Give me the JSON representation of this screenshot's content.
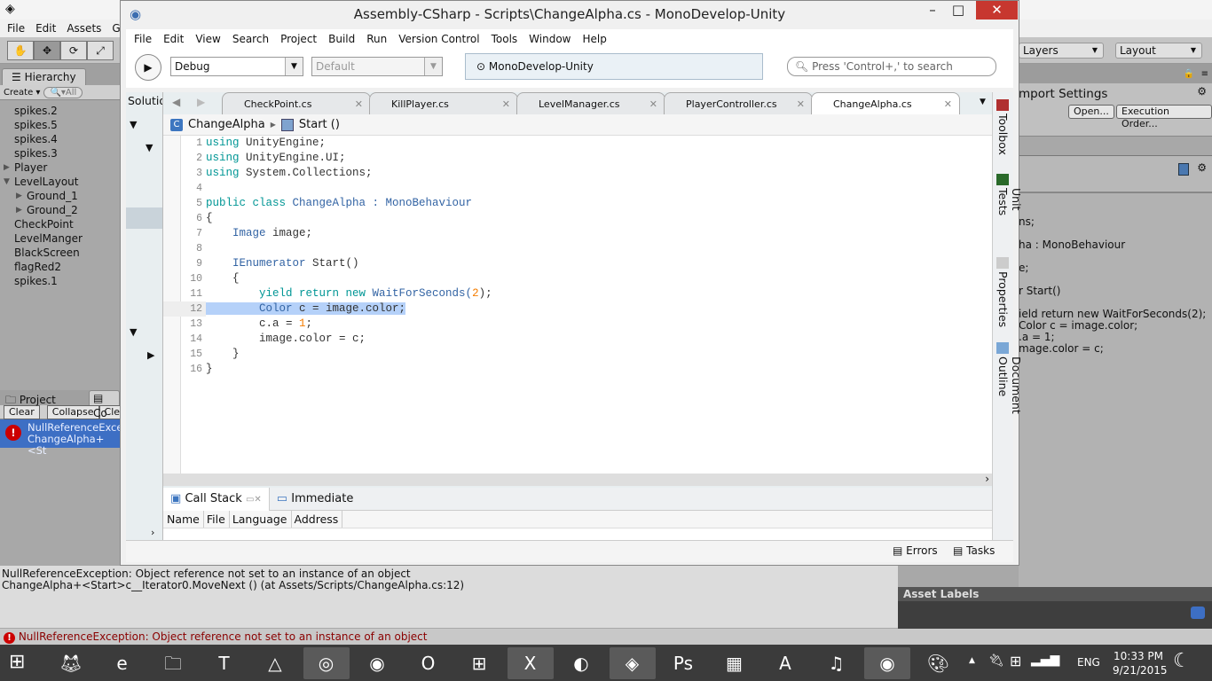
{
  "unity": {
    "menu": [
      "File",
      "Edit",
      "Assets",
      "Ga"
    ],
    "tools": [
      "hand-icon",
      "move-icon",
      "rotate-icon",
      "scale-icon"
    ],
    "hierarchy": {
      "tab": "Hierarchy",
      "create": "Create",
      "search": "All",
      "items": [
        {
          "label": "spikes.2",
          "indent": 0,
          "arrow": ""
        },
        {
          "label": "spikes.5",
          "indent": 0,
          "arrow": ""
        },
        {
          "label": "spikes.4",
          "indent": 0,
          "arrow": ""
        },
        {
          "label": "spikes.3",
          "indent": 0,
          "arrow": ""
        },
        {
          "label": "Player",
          "indent": 0,
          "arrow": "▶"
        },
        {
          "label": "LevelLayout",
          "indent": 0,
          "arrow": "▼"
        },
        {
          "label": "Ground_1",
          "indent": 1,
          "arrow": "▶"
        },
        {
          "label": "Ground_2",
          "indent": 1,
          "arrow": "▶"
        },
        {
          "label": "CheckPoint",
          "indent": 0,
          "arrow": ""
        },
        {
          "label": "LevelManger",
          "indent": 0,
          "arrow": ""
        },
        {
          "label": "BlackScreen",
          "indent": 0,
          "arrow": ""
        },
        {
          "label": "flagRed2",
          "indent": 0,
          "arrow": ""
        },
        {
          "label": "spikes.1",
          "indent": 0,
          "arrow": ""
        }
      ]
    },
    "project_tab": "Project",
    "console_tab": "Co",
    "console_buttons": [
      "Clear",
      "Collapse",
      "Clear"
    ],
    "console_entry": {
      "line1": "NullReferenceExce",
      "line2": "ChangeAlpha+<St"
    },
    "console_detail": [
      "NullReferenceException: Object reference not set to an instance of an object",
      "ChangeAlpha+<Start>c__Iterator0.MoveNext () (at Assets/Scripts/ChangeAlpha.cs:12)"
    ],
    "status": "NullReferenceException: Object reference not set to an instance of an object",
    "layers": "Layers",
    "layout": "Layout",
    "inspector": {
      "title": "Import Settings",
      "open": "Open...",
      "execution_order": "Execution Order...",
      "preview": [
        "ns;",
        "",
        "ha : MonoBehaviour",
        "",
        "e;",
        "",
        "r Start()",
        "",
        "ield return new WaitForSeconds(2);",
        "Color c = image.color;",
        ".a = 1;",
        "mage.color = c;"
      ]
    },
    "asset_labels": "Asset Labels"
  },
  "md": {
    "title": "Assembly-CSharp - Scripts\\ChangeAlpha.cs - MonoDevelop-Unity",
    "menu": [
      "File",
      "Edit",
      "View",
      "Search",
      "Project",
      "Build",
      "Run",
      "Version Control",
      "Tools",
      "Window",
      "Help"
    ],
    "config": "Debug",
    "platform": "Default",
    "status_box": "MonoDevelop-Unity",
    "search_placeholder": "Press 'Control+,' to search",
    "solution_label": "Solutio",
    "tabs": [
      {
        "label": "CheckPoint.cs",
        "active": false
      },
      {
        "label": "KillPlayer.cs",
        "active": false
      },
      {
        "label": "LevelManager.cs",
        "active": false
      },
      {
        "label": "PlayerController.cs",
        "active": false
      },
      {
        "label": "ChangeAlpha.cs",
        "active": true
      }
    ],
    "breadcrumb": {
      "class": "ChangeAlpha",
      "method": "Start ()"
    },
    "highlighted_line": 12,
    "code": [
      [
        [
          "using",
          "kw"
        ],
        [
          " UnityEngine;",
          "pl"
        ]
      ],
      [
        [
          "using",
          "kw"
        ],
        [
          " UnityEngine.UI;",
          "pl"
        ]
      ],
      [
        [
          "using",
          "kw"
        ],
        [
          " System.Collections;",
          "pl"
        ]
      ],
      [],
      [
        [
          "public class",
          "kw"
        ],
        [
          " ChangeAlpha : ",
          "ty"
        ],
        [
          "MonoBehaviour",
          "ty"
        ]
      ],
      [
        [
          "{",
          "pl"
        ]
      ],
      [
        [
          "    Image",
          "ty"
        ],
        [
          " image;",
          "pl"
        ]
      ],
      [],
      [
        [
          "    IEnumerator",
          "ty"
        ],
        [
          " Start()",
          "pl"
        ]
      ],
      [
        [
          "    {",
          "pl"
        ]
      ],
      [
        [
          "        yield return new",
          "kw"
        ],
        [
          " WaitForSeconds(",
          "ty"
        ],
        [
          "2",
          "nu"
        ],
        [
          ");",
          "pl"
        ]
      ],
      [
        [
          "        Color",
          "ty"
        ],
        [
          " c = image.color;",
          "pl"
        ]
      ],
      [
        [
          "        c.a = ",
          "pl"
        ],
        [
          "1",
          "nu"
        ],
        [
          ";",
          "pl"
        ]
      ],
      [
        [
          "        image.color = c;",
          "pl"
        ]
      ],
      [
        [
          "    }",
          "pl"
        ]
      ],
      [
        [
          "}",
          "pl"
        ]
      ]
    ],
    "bottom_tabs": [
      "Call Stack",
      "Immediate"
    ],
    "callstack_columns": [
      "Name",
      "File",
      "Language",
      "Address"
    ],
    "side_pads": [
      "Toolbox",
      "Unit Tests",
      "Properties",
      "Document Outline"
    ],
    "status_items": [
      "Errors",
      "Tasks"
    ]
  },
  "taskbar": {
    "apps": [
      "firefox",
      "internet-explorer",
      "file-explorer",
      "t-app",
      "google-drive",
      "chrome",
      "firefox-dev",
      "opera",
      "store",
      "excel",
      "app",
      "unity",
      "photoshop",
      "app2",
      "acrobat",
      "itunes",
      "monodevelop",
      "paint"
    ],
    "lang": "ENG",
    "time": "10:33 PM",
    "date": "9/21/2015"
  },
  "colors": {
    "keyword": "#009695",
    "type": "#3364a4",
    "number": "#f57d00",
    "selection": "#b5d1f9",
    "console_selected": "#3d6fc4"
  }
}
